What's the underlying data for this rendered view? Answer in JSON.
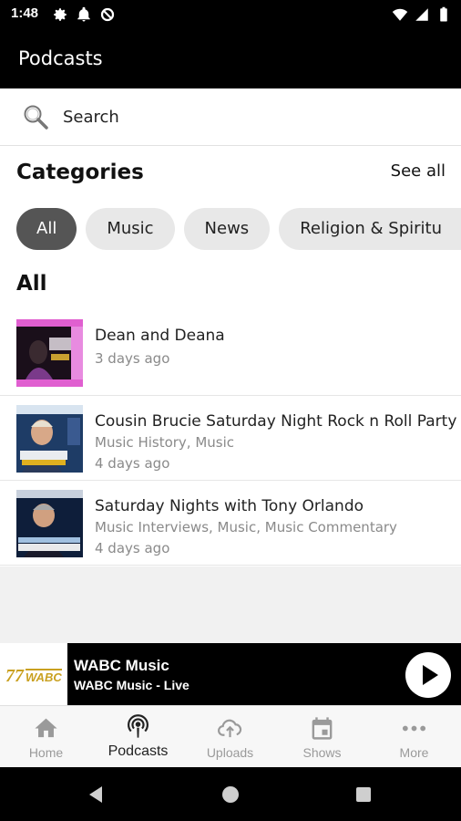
{
  "status_bar": {
    "time": "1:48"
  },
  "app_bar": {
    "title": "Podcasts"
  },
  "search": {
    "placeholder": "Search"
  },
  "categories": {
    "title": "Categories",
    "see_all": "See all",
    "chips": [
      "All",
      "Music",
      "News",
      "Religion & Spiritu"
    ],
    "selected": "All"
  },
  "section": {
    "title": "All"
  },
  "podcasts": [
    {
      "title": "Dean and Deana",
      "categories": "",
      "date": "3 days ago"
    },
    {
      "title": "Cousin Brucie Saturday Night Rock n Roll Party",
      "categories": "Music History, Music",
      "date": "4 days ago"
    },
    {
      "title": "Saturday Nights with Tony Orlando",
      "categories": "Music Interviews, Music, Music Commentary",
      "date": "4 days ago"
    }
  ],
  "mini_player": {
    "title": "WABC Music",
    "subtitle": "WABC Music - Live",
    "logo_text": "77 WABC"
  },
  "bottom_nav": {
    "items": [
      {
        "label": "Home",
        "icon": "home-icon"
      },
      {
        "label": "Podcasts",
        "icon": "podcast-icon"
      },
      {
        "label": "Uploads",
        "icon": "cloud-upload-icon"
      },
      {
        "label": "Shows",
        "icon": "calendar-icon"
      },
      {
        "label": "More",
        "icon": "more-icon"
      }
    ],
    "active": "Podcasts"
  },
  "colors": {
    "chip_active": "#555555",
    "chip": "#e8e8e8",
    "bar": "#000000",
    "nav_inactive": "#9a9a9a"
  }
}
